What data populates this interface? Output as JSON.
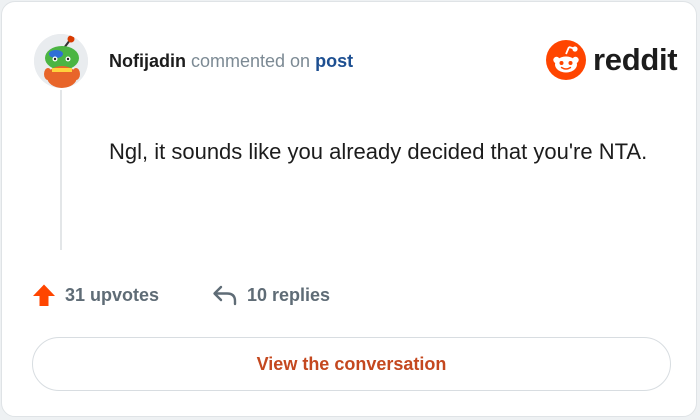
{
  "comment": {
    "author": "Nofijadin",
    "action_text": " commented on ",
    "post_link": "post",
    "body": "Ngl, it sounds like you already decided that you're NTA."
  },
  "brand": {
    "wordmark": "reddit",
    "icon": "reddit-logo-icon",
    "accent_color": "#ff4500"
  },
  "stats": {
    "upvotes": "31 upvotes",
    "upvote_icon": "upvote-arrow-icon",
    "upvote_color": "#ff4500",
    "replies": "10 replies",
    "reply_icon": "reply-arrow-icon"
  },
  "actions": {
    "view_conversation": "View the conversation"
  },
  "avatar": {
    "icon": "snoo-avatar-icon"
  }
}
